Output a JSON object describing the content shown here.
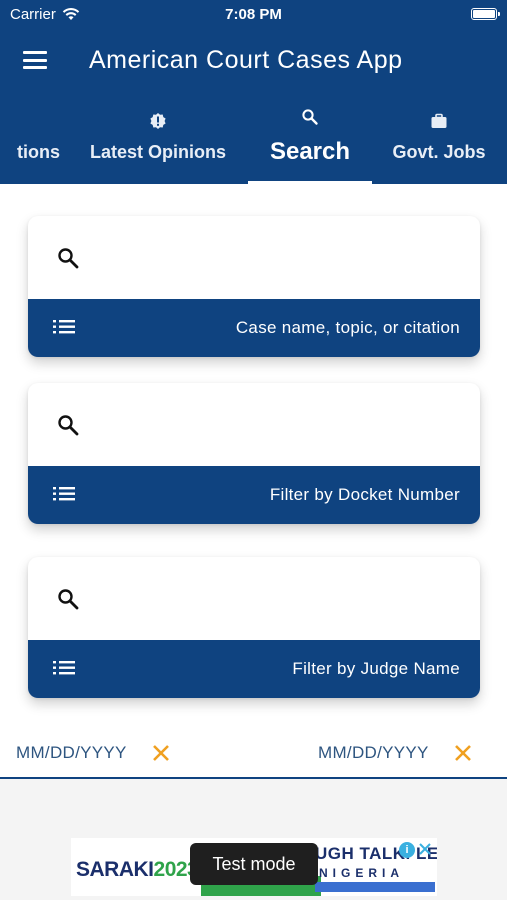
{
  "status_bar": {
    "carrier": "Carrier",
    "time": "7:08 PM"
  },
  "app_bar": {
    "title": "American Court Cases App"
  },
  "tabs": [
    {
      "label": "tions",
      "icon": "none"
    },
    {
      "label": "Latest Opinions",
      "icon": "alert-badge-icon"
    },
    {
      "label": "Search",
      "icon": "search-icon",
      "active": true
    },
    {
      "label": "Govt. Jobs",
      "icon": "briefcase-icon"
    }
  ],
  "search_cards": [
    {
      "value": "",
      "placeholder": "",
      "footer_label": "Case name, topic, or citation"
    },
    {
      "value": "",
      "placeholder": "",
      "footer_label": "Filter by Docket Number"
    },
    {
      "value": "",
      "placeholder": "",
      "footer_label": "Filter by Judge Name"
    }
  ],
  "date_filters": {
    "from_placeholder": "MM/DD/YYYY",
    "to_placeholder": "MM/DD/YYYY"
  },
  "ad": {
    "left_text": "SARAKI",
    "left_text_accent": "2023",
    "right_text_top": "UGH TALK. LET'S",
    "right_text_bottom": "NIGERIA",
    "info_glyph": "i",
    "test_mode_label": "Test mode"
  },
  "colors": {
    "primary": "#0f4380",
    "clear_icon": "#f0a020",
    "date_text": "#2e5580",
    "background": "#ffffff"
  }
}
